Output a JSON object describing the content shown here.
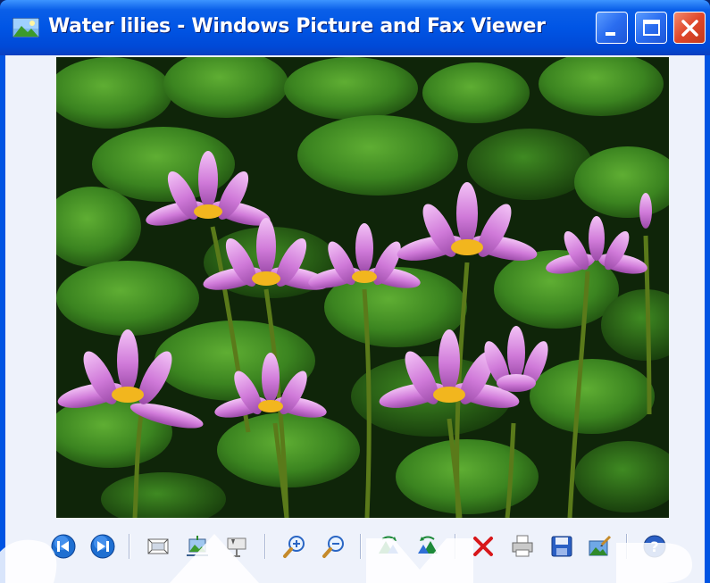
{
  "window": {
    "title": "Water lilies - Windows Picture and Fax Viewer",
    "controls": {
      "minimize": "minimize",
      "maximize": "maximize",
      "close": "close"
    }
  },
  "image": {
    "subject": "Water lilies",
    "colors": {
      "pad_dark": "#1d4a12",
      "pad_light": "#4f9a2a",
      "petal": "#d27ae0",
      "petal_light": "#f0b9f2",
      "center": "#f2b61e"
    }
  },
  "toolbar": {
    "groups": [
      [
        "previous-image-icon",
        "next-image-icon"
      ],
      [
        "best-fit-icon",
        "actual-size-icon",
        "slideshow-icon"
      ],
      [
        "zoom-in-icon",
        "zoom-out-icon"
      ],
      [
        "rotate-clockwise-icon",
        "rotate-counterclockwise-icon"
      ],
      [
        "delete-icon",
        "print-icon",
        "save-icon",
        "edit-icon"
      ],
      [
        "help-icon"
      ]
    ]
  },
  "theme": {
    "titlebar": "#0054e3",
    "client_bg": "#eef2fb",
    "close_button": "#e0472a"
  }
}
